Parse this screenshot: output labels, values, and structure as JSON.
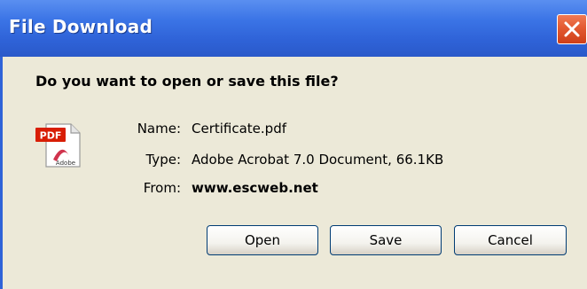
{
  "window": {
    "title": "File Download",
    "close_icon": "close-icon"
  },
  "dialog": {
    "question": "Do you want to open or save this file?",
    "file_icon": "pdf-file-icon",
    "icon_badge": "PDF",
    "icon_brand": "Adobe",
    "fields": {
      "name_label": "Name:",
      "name_value": "Certificate.pdf",
      "type_label": "Type:",
      "type_value": "Adobe Acrobat 7.0 Document, 66.1KB",
      "from_label": "From:",
      "from_value": "www.escweb.net"
    }
  },
  "buttons": {
    "open": "Open",
    "save": "Save",
    "cancel": "Cancel"
  },
  "colors": {
    "titlebar": "#2f63d8",
    "client_bg": "#ece9d8",
    "close_button": "#e35a31",
    "pdf_badge": "#d81e05"
  }
}
